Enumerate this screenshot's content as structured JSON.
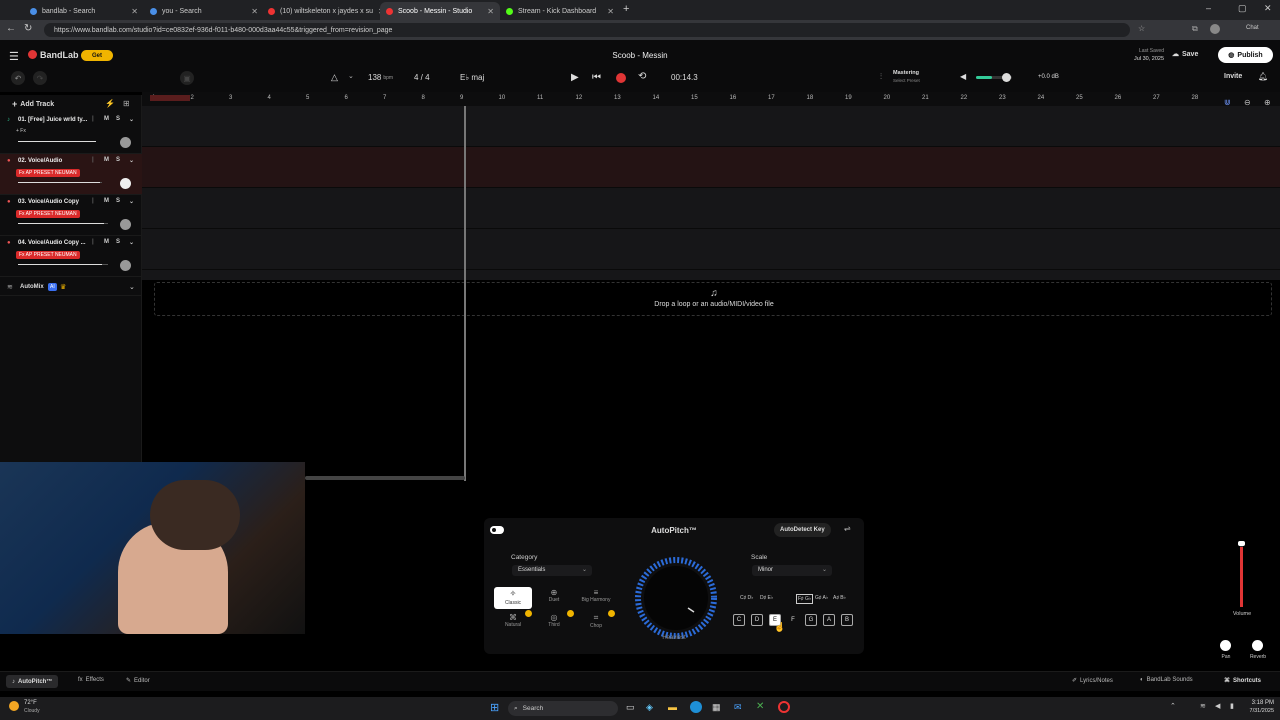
{
  "browser": {
    "tabs": [
      {
        "label": "bandlab - Search",
        "color": "#4a8fe7"
      },
      {
        "label": "you - Search",
        "color": "#4a8fe7"
      },
      {
        "label": "(10) wiltskeleton x jaydes x su",
        "color": "#e33"
      },
      {
        "label": "Scoob - Messin - Studio",
        "color": "#e33"
      },
      {
        "label": "Stream - Kick Dashboard",
        "color": "#53fc18"
      }
    ],
    "new_tab": "+",
    "url": "https://www.bandlab.com/studio?id=ce0832ef-936d-f011-b480-000d3aa44c55&triggered_from=revision_page",
    "profile": "Chat"
  },
  "header": {
    "brand": "BandLab",
    "get_label": "Get",
    "project_title": "Scoob - Messin",
    "last_saved_label": "Last Saved",
    "last_saved_date": "Jul 30, 2025",
    "save": "Save",
    "publish": "Publish",
    "invite": "Invite",
    "bpm": "138",
    "bpm_unit": "bpm",
    "time_sig": "4 / 4",
    "key": "E♭ maj",
    "time": "00:14.3",
    "mastering": "Mastering",
    "select_preset": "Select Preset",
    "db": "+0.0 dB",
    "accent": "#e03535"
  },
  "sidebar": {
    "add_track": "Add Track",
    "tracks": [
      {
        "name": "01. [Free] Juice wrld ty...",
        "fx": "+ Fx",
        "preset": false,
        "m": "M",
        "s": "S",
        "vol": 0.8
      },
      {
        "name": "02. Voice/Audio",
        "fx": "Fx AP PRESET NEUMAN",
        "preset": true,
        "m": "M",
        "s": "S",
        "vol": 0.72
      },
      {
        "name": "03. Voice/Audio Copy",
        "fx": "Fx AP PRESET NEUMAN",
        "preset": true,
        "m": "M",
        "s": "S",
        "vol": 0.8
      },
      {
        "name": "04. Voice/Audio Copy ...",
        "fx": "Fx AP PRESET NEUMAN",
        "preset": true,
        "m": "M",
        "s": "S",
        "vol": 0.8
      }
    ],
    "automix": "AutoMix",
    "ai": "AI"
  },
  "ruler": [
    "1",
    "2",
    "3",
    "4",
    "5",
    "6",
    "7",
    "8",
    "9",
    "10",
    "11",
    "12",
    "13",
    "14",
    "15",
    "16",
    "17",
    "18",
    "19",
    "20",
    "21",
    "22",
    "23",
    "24",
    "25",
    "26",
    "27",
    "28"
  ],
  "drop_hint": "Drop a loop or an audio/MIDI/video file",
  "autopitch": {
    "title": "AutoPitch™",
    "autodetect": "AutoDetect Key",
    "category_label": "Category",
    "category_value": "Essentials",
    "scale_label": "Scale",
    "scale_value": "Minor",
    "styles": [
      "Classic",
      "Duet",
      "Big Harmony",
      "Natural",
      "Third",
      "Chop"
    ],
    "knob_label": "Heaviest",
    "sharps": [
      "C♯ D♭",
      "D♯ E♭",
      "F♯ G♭",
      "G♯ A♭",
      "A♯ B♭"
    ],
    "naturals": [
      "C",
      "D",
      "E",
      "F",
      "G",
      "A",
      "B"
    ]
  },
  "mixer": {
    "volume": "Volume",
    "pan": "Pan",
    "reverb": "Reverb"
  },
  "footer": {
    "autopitch": "AutoPitch™",
    "effects": "Effects",
    "editor": "Editor",
    "lyrics": "Lyrics/Notes",
    "sounds": "BandLab Sounds",
    "shortcuts": "Shortcuts"
  },
  "taskbar": {
    "temp": "72°F",
    "weather": "Cloudy",
    "search": "Search",
    "time": "3:18 PM",
    "date": "7/31/2025"
  }
}
